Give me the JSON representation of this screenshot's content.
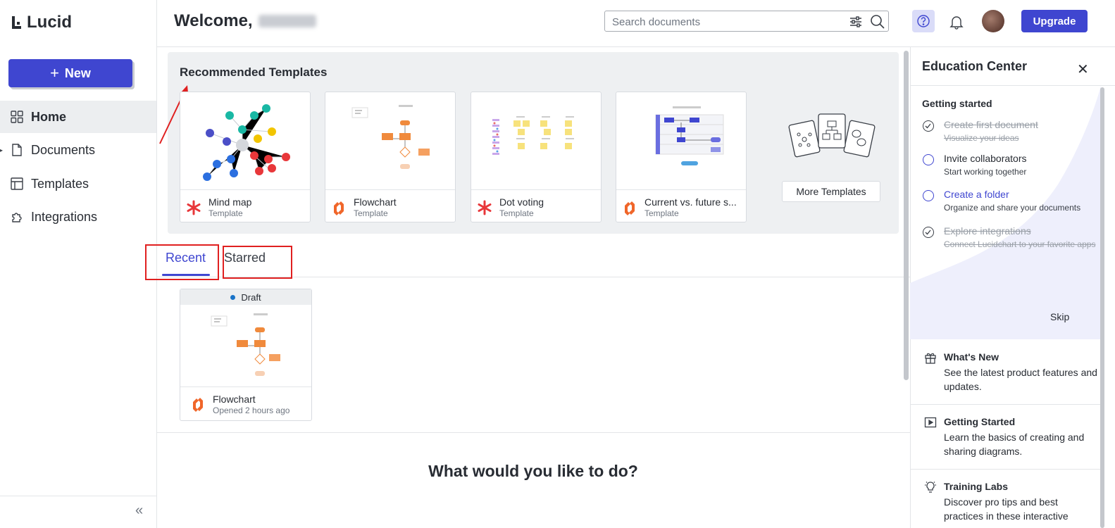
{
  "app": {
    "name": "Lucid"
  },
  "sidebar": {
    "new_label": "New",
    "items": [
      {
        "label": "Home",
        "icon": "grid-icon",
        "active": true
      },
      {
        "label": "Documents",
        "icon": "document-icon",
        "active": false
      },
      {
        "label": "Templates",
        "icon": "layout-icon",
        "active": false
      },
      {
        "label": "Integrations",
        "icon": "puzzle-icon",
        "active": false
      }
    ],
    "collapse_icon": "double-chevron-left-icon"
  },
  "header": {
    "welcome": "Welcome,",
    "search_placeholder": "Search documents",
    "upgrade_label": "Upgrade"
  },
  "templates": {
    "title": "Recommended Templates",
    "cards": [
      {
        "name": "Mind map",
        "sub": "Template",
        "icon": "asterisk-icon"
      },
      {
        "name": "Flowchart",
        "sub": "Template",
        "icon": "lucidchart-icon"
      },
      {
        "name": "Dot voting",
        "sub": "Template",
        "icon": "asterisk-icon"
      },
      {
        "name": "Current vs. future s...",
        "sub": "Template",
        "icon": "lucidchart-icon"
      }
    ],
    "more_label": "More Templates"
  },
  "tabs": {
    "recent": "Recent",
    "starred": "Starred"
  },
  "recent": {
    "badge": "Draft",
    "name": "Flowchart",
    "sub": "Opened 2 hours ago"
  },
  "prompt": "What would you like to do?",
  "education": {
    "title": "Education Center",
    "getting_started": "Getting started",
    "tasks": [
      {
        "label": "Create first document",
        "sub": "Visualize your ideas",
        "done": true
      },
      {
        "label": "Invite collaborators",
        "sub": "Start working together",
        "done": false
      },
      {
        "label": "Create a folder",
        "sub": "Organize and share your documents",
        "done": false
      },
      {
        "label": "Explore integrations",
        "sub": "Connect Lucidchart to your favorite apps",
        "done": true
      }
    ],
    "skip": "Skip",
    "resources": [
      {
        "title": "What's New",
        "desc": "See the latest product features and updates.",
        "icon": "gift-icon"
      },
      {
        "title": "Getting Started",
        "desc": "Learn the basics of creating and sharing diagrams.",
        "icon": "play-icon"
      },
      {
        "title": "Training Labs",
        "desc": "Discover pro tips and best practices in these interactive",
        "icon": "lightbulb-icon"
      }
    ]
  },
  "colors": {
    "accent": "#3f46d0",
    "orange": "#f0662a",
    "red": "#e8373a",
    "annotation": "#e02020"
  }
}
